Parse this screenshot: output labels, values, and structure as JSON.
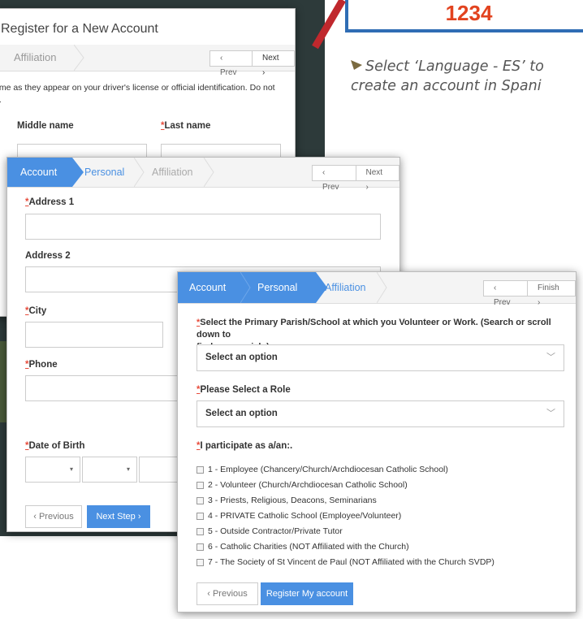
{
  "callout": {
    "number": "1234",
    "note_line1": "Select ‘Language - ES’ to",
    "note_line2": "create an account in Spani"
  },
  "back_panel": {
    "title": "Register for a New Account",
    "tab_affiliation": "Affiliation",
    "prev": "Prev",
    "next": "Next",
    "instructions_line1": "ame as they appear on your driver's license or official identification. Do not",
    "instructions_line2": "n.",
    "middle_name_label": "Middle name",
    "last_name_label": "Last name",
    "required_mark": "*"
  },
  "middle_panel": {
    "tabs": [
      "Account",
      "Personal",
      "Affiliation"
    ],
    "prev": "Prev",
    "next": "Next",
    "address1_label": "Address 1",
    "address2_label": "Address 2",
    "city_label": "City",
    "phone_label": "Phone",
    "dob_label": "Date of Birth",
    "previous_button": "Previous",
    "next_step_button": "Next Step",
    "required_mark": "*"
  },
  "front_panel": {
    "tabs": [
      "Account",
      "Personal",
      "Affiliation"
    ],
    "prev": "Prev",
    "finish": "Finish",
    "parish_label_line1": "Select the Primary Parish/School at which you Volunteer or Work. (Search or scroll down to",
    "parish_label_line2": "find your parish.)",
    "parish_select": "Select an option",
    "role_label": "Please Select a Role",
    "role_select": "Select an option",
    "participate_label": "I participate as a/an:.",
    "options": [
      "1 - Employee (Chancery/Church/Archdiocesan Catholic School)",
      "2 - Volunteer (Church/Archdiocesan Catholic School)",
      "3 - Priests, Religious, Deacons, Seminarians",
      "4 - PRIVATE Catholic School (Employee/Volunteer)",
      "5 - Outside Contractor/Private Tutor",
      "6 - Catholic Charities (NOT Affiliated with the Church)",
      "7 - The Society of St Vincent de Paul (NOT Affiliated with the Church SVDP)"
    ],
    "previous_button": "Previous",
    "register_button": "Register My account",
    "required_mark": "*"
  },
  "colors": {
    "accent": "#4a90e2",
    "required": "#e74c3c",
    "callout_number": "#e2431f",
    "callout_border": "#2f6db4",
    "pointer_line": "#c0282d"
  },
  "icons": {
    "chevron_left": "‹",
    "chevron_right": "›",
    "caret_down": "▾",
    "select_chevron": "﹀"
  }
}
